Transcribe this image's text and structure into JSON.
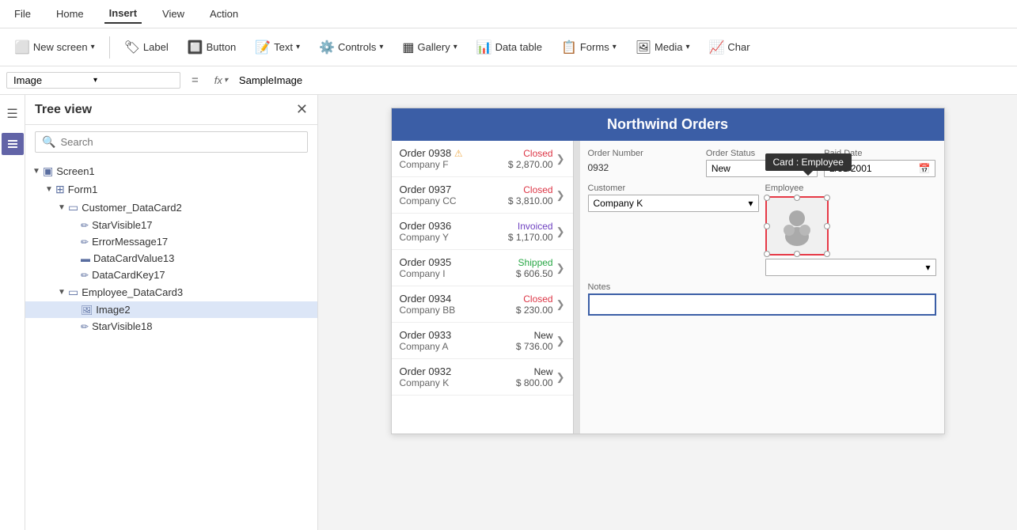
{
  "menubar": {
    "items": [
      "File",
      "Home",
      "Insert",
      "View",
      "Action"
    ],
    "active": "Insert"
  },
  "toolbar": {
    "new_screen": "New screen",
    "label": "Label",
    "button": "Button",
    "text": "Text",
    "controls": "Controls",
    "gallery": "Gallery",
    "data_table": "Data table",
    "forms": "Forms",
    "media": "Media",
    "charts": "Char"
  },
  "formula_bar": {
    "selector_value": "Image",
    "eq": "=",
    "fx": "fx",
    "formula_value": "SampleImage"
  },
  "tree_view": {
    "title": "Tree view",
    "search_placeholder": "Search",
    "items": [
      {
        "id": "screen1",
        "label": "Screen1",
        "level": 0,
        "icon": "screen",
        "expanded": true
      },
      {
        "id": "form1",
        "label": "Form1",
        "level": 1,
        "icon": "form",
        "expanded": true
      },
      {
        "id": "customer_dc2",
        "label": "Customer_DataCard2",
        "level": 2,
        "icon": "datacard",
        "expanded": true
      },
      {
        "id": "starvisible17",
        "label": "StarVisible17",
        "level": 3,
        "icon": "pen"
      },
      {
        "id": "errormessage17",
        "label": "ErrorMessage17",
        "level": 3,
        "icon": "pen"
      },
      {
        "id": "datacardvalue13",
        "label": "DataCardValue13",
        "level": 3,
        "icon": "input"
      },
      {
        "id": "datacardkey17",
        "label": "DataCardKey17",
        "level": 3,
        "icon": "pen"
      },
      {
        "id": "employee_dc3",
        "label": "Employee_DataCard3",
        "level": 2,
        "icon": "datacard",
        "expanded": true
      },
      {
        "id": "image2",
        "label": "Image2",
        "level": 3,
        "icon": "image",
        "selected": true
      },
      {
        "id": "starvisible18",
        "label": "StarVisible18",
        "level": 3,
        "icon": "pen"
      }
    ]
  },
  "app_preview": {
    "title": "Northwind Orders",
    "orders": [
      {
        "num": "Order 0938",
        "company": "Company F",
        "status": "Closed",
        "amount": "$ 2,870.00",
        "status_type": "closed",
        "warn": true
      },
      {
        "num": "Order 0937",
        "company": "Company CC",
        "status": "Closed",
        "amount": "$ 3,810.00",
        "status_type": "closed"
      },
      {
        "num": "Order 0936",
        "company": "Company Y",
        "status": "Invoiced",
        "amount": "$ 1,170.00",
        "status_type": "invoiced"
      },
      {
        "num": "Order 0935",
        "company": "Company I",
        "status": "Shipped",
        "amount": "$ 606.50",
        "status_type": "shipped"
      },
      {
        "num": "Order 0934",
        "company": "Company BB",
        "status": "Closed",
        "amount": "$ 230.00",
        "status_type": "closed"
      },
      {
        "num": "Order 0933",
        "company": "Company A",
        "status": "New",
        "amount": "$ 736.00",
        "status_type": "new"
      },
      {
        "num": "Order 0932",
        "company": "Company K",
        "status": "New",
        "amount": "$ 800.00",
        "status_type": "new"
      }
    ],
    "detail": {
      "order_number_label": "Order Number",
      "order_number_value": "0932",
      "order_status_label": "Order Status",
      "order_status_value": "New",
      "paid_date_label": "Paid Date",
      "paid_date_value": "2/31/2001",
      "customer_label": "Customer",
      "customer_value": "Company K",
      "employee_label": "Employee",
      "notes_label": "Notes"
    },
    "tooltip": "Card : Employee"
  }
}
